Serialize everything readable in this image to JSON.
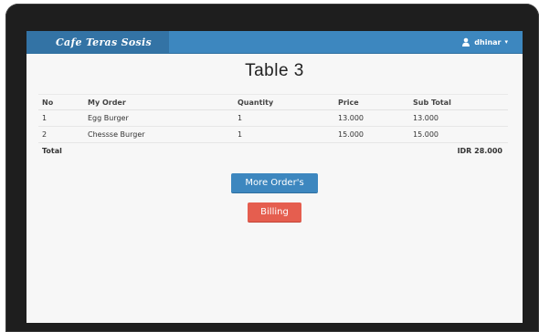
{
  "navbar": {
    "brand": "Cafe Teras Sosis",
    "user": "dhinar",
    "user_icon": "user-icon",
    "caret": "▾"
  },
  "page": {
    "title": "Table 3"
  },
  "table": {
    "headers": [
      "No",
      "My Order",
      "Quantity",
      "Price",
      "Sub Total"
    ],
    "rows": [
      [
        "1",
        "Egg Burger",
        "1",
        "13.000",
        "13.000"
      ],
      [
        "2",
        "Chessse Burger",
        "1",
        "15.000",
        "15.000"
      ]
    ],
    "total_label": "Total",
    "total_value": "IDR 28.000"
  },
  "buttons": {
    "more_orders": "More Order's",
    "billing": "Billing"
  },
  "colors": {
    "navbar": "#3d87bf",
    "brand_bg": "#3373a5",
    "billing": "#e55e4f"
  }
}
